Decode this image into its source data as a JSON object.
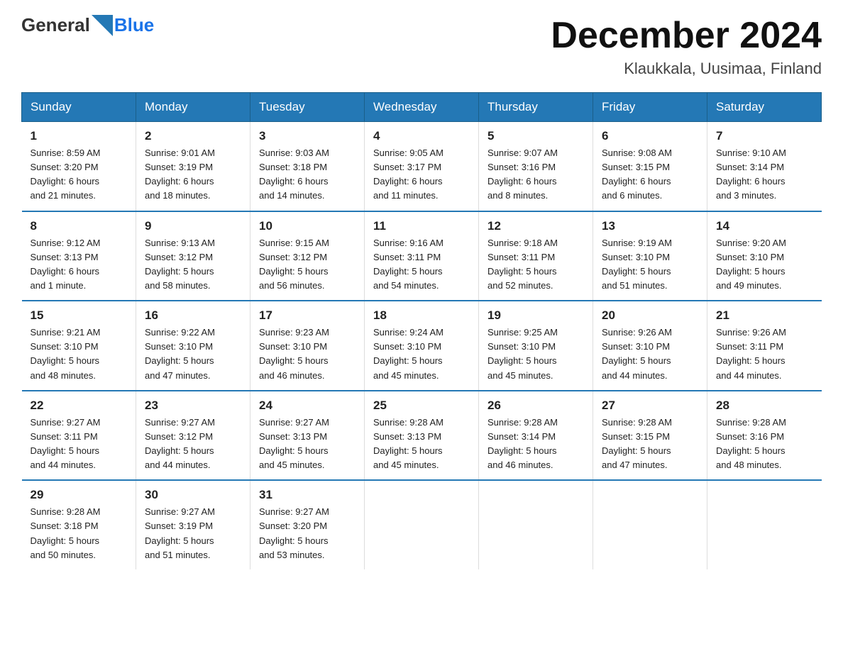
{
  "header": {
    "logo_general": "General",
    "logo_blue": "Blue",
    "title": "December 2024",
    "subtitle": "Klaukkala, Uusimaa, Finland"
  },
  "days_of_week": [
    "Sunday",
    "Monday",
    "Tuesday",
    "Wednesday",
    "Thursday",
    "Friday",
    "Saturday"
  ],
  "weeks": [
    [
      {
        "day": "1",
        "info": "Sunrise: 8:59 AM\nSunset: 3:20 PM\nDaylight: 6 hours\nand 21 minutes."
      },
      {
        "day": "2",
        "info": "Sunrise: 9:01 AM\nSunset: 3:19 PM\nDaylight: 6 hours\nand 18 minutes."
      },
      {
        "day": "3",
        "info": "Sunrise: 9:03 AM\nSunset: 3:18 PM\nDaylight: 6 hours\nand 14 minutes."
      },
      {
        "day": "4",
        "info": "Sunrise: 9:05 AM\nSunset: 3:17 PM\nDaylight: 6 hours\nand 11 minutes."
      },
      {
        "day": "5",
        "info": "Sunrise: 9:07 AM\nSunset: 3:16 PM\nDaylight: 6 hours\nand 8 minutes."
      },
      {
        "day": "6",
        "info": "Sunrise: 9:08 AM\nSunset: 3:15 PM\nDaylight: 6 hours\nand 6 minutes."
      },
      {
        "day": "7",
        "info": "Sunrise: 9:10 AM\nSunset: 3:14 PM\nDaylight: 6 hours\nand 3 minutes."
      }
    ],
    [
      {
        "day": "8",
        "info": "Sunrise: 9:12 AM\nSunset: 3:13 PM\nDaylight: 6 hours\nand 1 minute."
      },
      {
        "day": "9",
        "info": "Sunrise: 9:13 AM\nSunset: 3:12 PM\nDaylight: 5 hours\nand 58 minutes."
      },
      {
        "day": "10",
        "info": "Sunrise: 9:15 AM\nSunset: 3:12 PM\nDaylight: 5 hours\nand 56 minutes."
      },
      {
        "day": "11",
        "info": "Sunrise: 9:16 AM\nSunset: 3:11 PM\nDaylight: 5 hours\nand 54 minutes."
      },
      {
        "day": "12",
        "info": "Sunrise: 9:18 AM\nSunset: 3:11 PM\nDaylight: 5 hours\nand 52 minutes."
      },
      {
        "day": "13",
        "info": "Sunrise: 9:19 AM\nSunset: 3:10 PM\nDaylight: 5 hours\nand 51 minutes."
      },
      {
        "day": "14",
        "info": "Sunrise: 9:20 AM\nSunset: 3:10 PM\nDaylight: 5 hours\nand 49 minutes."
      }
    ],
    [
      {
        "day": "15",
        "info": "Sunrise: 9:21 AM\nSunset: 3:10 PM\nDaylight: 5 hours\nand 48 minutes."
      },
      {
        "day": "16",
        "info": "Sunrise: 9:22 AM\nSunset: 3:10 PM\nDaylight: 5 hours\nand 47 minutes."
      },
      {
        "day": "17",
        "info": "Sunrise: 9:23 AM\nSunset: 3:10 PM\nDaylight: 5 hours\nand 46 minutes."
      },
      {
        "day": "18",
        "info": "Sunrise: 9:24 AM\nSunset: 3:10 PM\nDaylight: 5 hours\nand 45 minutes."
      },
      {
        "day": "19",
        "info": "Sunrise: 9:25 AM\nSunset: 3:10 PM\nDaylight: 5 hours\nand 45 minutes."
      },
      {
        "day": "20",
        "info": "Sunrise: 9:26 AM\nSunset: 3:10 PM\nDaylight: 5 hours\nand 44 minutes."
      },
      {
        "day": "21",
        "info": "Sunrise: 9:26 AM\nSunset: 3:11 PM\nDaylight: 5 hours\nand 44 minutes."
      }
    ],
    [
      {
        "day": "22",
        "info": "Sunrise: 9:27 AM\nSunset: 3:11 PM\nDaylight: 5 hours\nand 44 minutes."
      },
      {
        "day": "23",
        "info": "Sunrise: 9:27 AM\nSunset: 3:12 PM\nDaylight: 5 hours\nand 44 minutes."
      },
      {
        "day": "24",
        "info": "Sunrise: 9:27 AM\nSunset: 3:13 PM\nDaylight: 5 hours\nand 45 minutes."
      },
      {
        "day": "25",
        "info": "Sunrise: 9:28 AM\nSunset: 3:13 PM\nDaylight: 5 hours\nand 45 minutes."
      },
      {
        "day": "26",
        "info": "Sunrise: 9:28 AM\nSunset: 3:14 PM\nDaylight: 5 hours\nand 46 minutes."
      },
      {
        "day": "27",
        "info": "Sunrise: 9:28 AM\nSunset: 3:15 PM\nDaylight: 5 hours\nand 47 minutes."
      },
      {
        "day": "28",
        "info": "Sunrise: 9:28 AM\nSunset: 3:16 PM\nDaylight: 5 hours\nand 48 minutes."
      }
    ],
    [
      {
        "day": "29",
        "info": "Sunrise: 9:28 AM\nSunset: 3:18 PM\nDaylight: 5 hours\nand 50 minutes."
      },
      {
        "day": "30",
        "info": "Sunrise: 9:27 AM\nSunset: 3:19 PM\nDaylight: 5 hours\nand 51 minutes."
      },
      {
        "day": "31",
        "info": "Sunrise: 9:27 AM\nSunset: 3:20 PM\nDaylight: 5 hours\nand 53 minutes."
      },
      {
        "day": "",
        "info": ""
      },
      {
        "day": "",
        "info": ""
      },
      {
        "day": "",
        "info": ""
      },
      {
        "day": "",
        "info": ""
      }
    ]
  ]
}
